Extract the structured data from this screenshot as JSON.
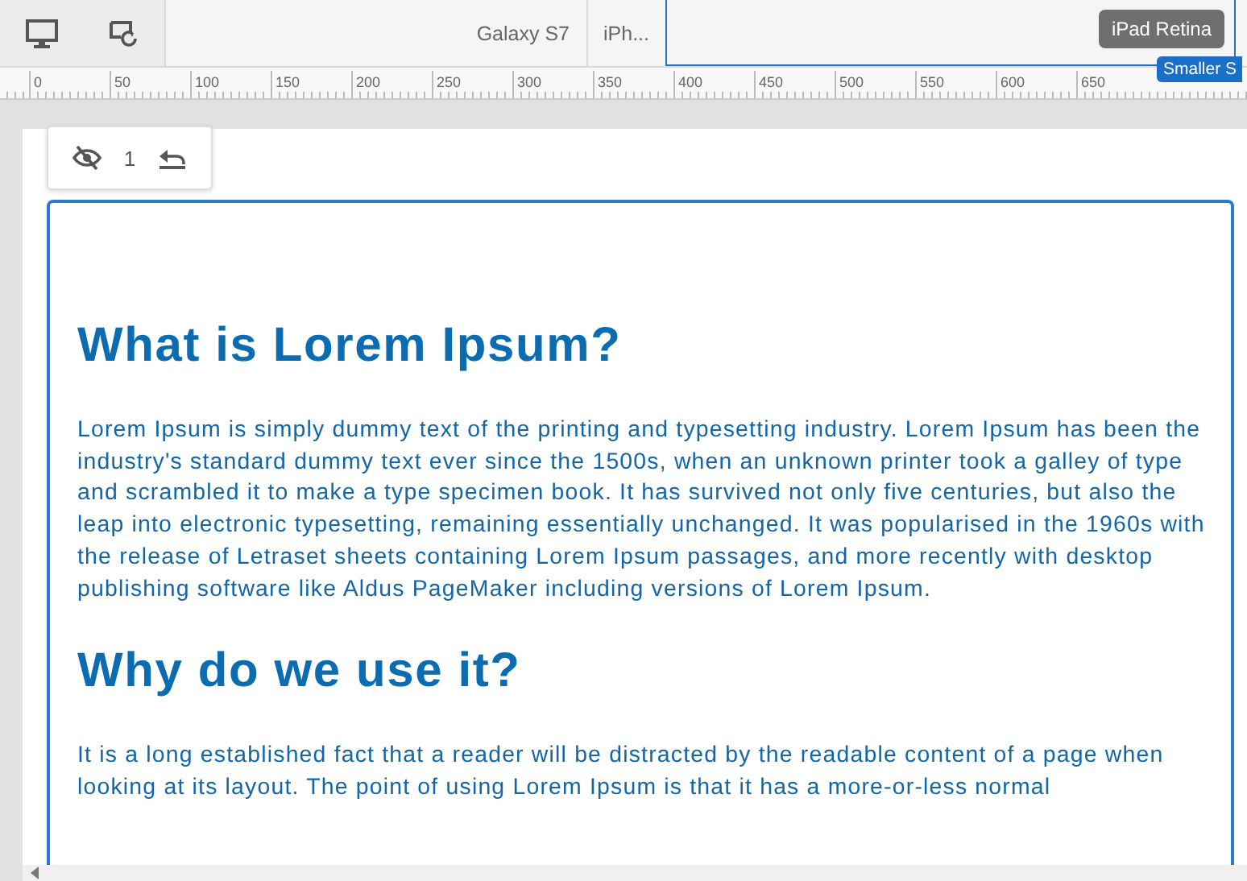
{
  "toolbar": {
    "device_tabs": [
      {
        "label": "Galaxy S7",
        "selected": false
      },
      {
        "label": "iPh...",
        "selected": false
      }
    ],
    "active_device": "iPad Retina",
    "tooltip": "Smaller S"
  },
  "ruler": {
    "labels": [
      "0",
      "50",
      "100",
      "150",
      "200",
      "250",
      "300",
      "350",
      "400",
      "450",
      "500",
      "550",
      "600",
      "650"
    ]
  },
  "inspector": {
    "hidden_count": "1"
  },
  "content": [
    {
      "kind": "heading",
      "text": "What is Lorem Ipsum?"
    },
    {
      "kind": "paragraph",
      "text": "Lorem Ipsum is simply dummy text of the printing and typesetting industry. Lorem Ipsum has been the industry's standard dummy text ever since the 1500s, when an unknown printer took a galley of type and scrambled it to make a type specimen book. It has survived not only five centuries, but also the leap into electronic typesetting, remaining essentially unchanged. It was popularised in the 1960s with the release of Letraset sheets containing Lorem Ipsum passages, and more recently with desktop publishing software like Aldus PageMaker including versions of Lorem Ipsum."
    },
    {
      "kind": "heading",
      "text": "Why do we use it?"
    },
    {
      "kind": "paragraph",
      "text": "It is a long established fact that a reader will be distracted by the readable content of a page when looking at its layout. The point of using Lorem Ipsum is that it has a more-or-less normal"
    }
  ]
}
